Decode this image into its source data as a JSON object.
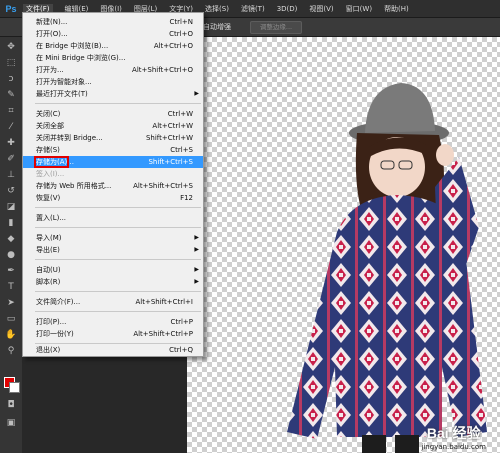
{
  "app": {
    "logo": "Ps"
  },
  "menubar": {
    "items": [
      "文件(F)",
      "编辑(E)",
      "图像(I)",
      "图层(L)",
      "文字(Y)",
      "选择(S)",
      "滤镜(T)",
      "3D(D)",
      "视图(V)",
      "窗口(W)",
      "帮助(H)"
    ]
  },
  "options": {
    "auto_enhance": "自动增强",
    "refine_edge": "调整边缘..."
  },
  "file_menu": {
    "items": [
      {
        "label": "新建(N)...",
        "shortcut": "Ctrl+N"
      },
      {
        "label": "打开(O)...",
        "shortcut": "Ctrl+O"
      },
      {
        "label": "在 Bridge 中浏览(B)...",
        "shortcut": "Alt+Ctrl+O"
      },
      {
        "label": "在 Mini Bridge 中浏览(G)...",
        "shortcut": ""
      },
      {
        "label": "打开为...",
        "shortcut": "Alt+Shift+Ctrl+O"
      },
      {
        "label": "打开为智能对象...",
        "shortcut": ""
      },
      {
        "label": "最近打开文件(T)",
        "shortcut": ""
      },
      {
        "label": "关闭(C)",
        "shortcut": "Ctrl+W"
      },
      {
        "label": "关闭全部",
        "shortcut": "Alt+Ctrl+W"
      },
      {
        "label": "关闭并转到 Bridge...",
        "shortcut": "Shift+Ctrl+W"
      },
      {
        "label": "存储(S)",
        "shortcut": "Ctrl+S"
      },
      {
        "label": "存储为(A)...",
        "shortcut": "Shift+Ctrl+S"
      },
      {
        "label": "签入(I)...",
        "shortcut": ""
      },
      {
        "label": "存储为 Web 所用格式...",
        "shortcut": "Alt+Shift+Ctrl+S"
      },
      {
        "label": "恢复(V)",
        "shortcut": "F12"
      },
      {
        "label": "置入(L)...",
        "shortcut": ""
      },
      {
        "label": "导入(M)",
        "shortcut": ""
      },
      {
        "label": "导出(E)",
        "shortcut": ""
      },
      {
        "label": "自动(U)",
        "shortcut": ""
      },
      {
        "label": "脚本(R)",
        "shortcut": ""
      },
      {
        "label": "文件简介(F)...",
        "shortcut": "Alt+Shift+Ctrl+I"
      },
      {
        "label": "打印(P)...",
        "shortcut": "Ctrl+P"
      },
      {
        "label": "打印一份(Y)",
        "shortcut": "Alt+Shift+Ctrl+P"
      },
      {
        "label": "退出(X)",
        "shortcut": "Ctrl+Q"
      }
    ]
  },
  "colors": {
    "foreground": "#e00000",
    "background": "#ffffff",
    "highlight": "#3399ff"
  },
  "watermark": {
    "brand": "Bai 经验",
    "url": "jingyan.baidu.com"
  }
}
